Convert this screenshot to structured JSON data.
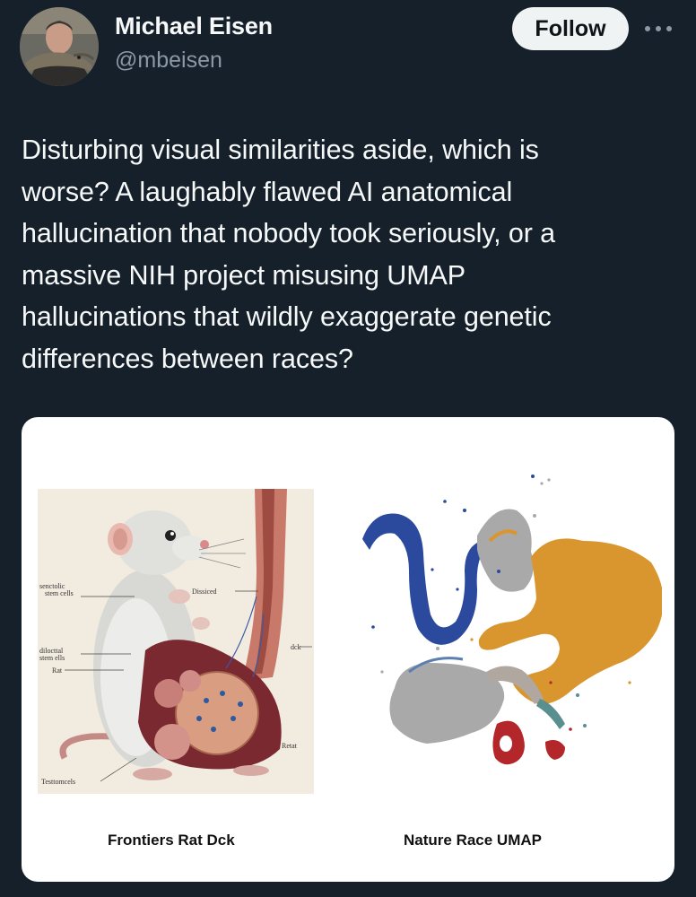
{
  "author": {
    "name": "Michael Eisen",
    "handle": "@mbeisen",
    "avatar_icon": "profile-photo-with-lizard"
  },
  "actions": {
    "follow_label": "Follow",
    "more_icon": "more-horizontal-icon"
  },
  "tweet": {
    "lines": [
      "Disturbing visual similarities aside, which is",
      "worse? A laughably flawed AI anatomical",
      "hallucination that nobody took seriously, or a",
      "massive NIH project misusing UMAP",
      "hallucinations that wildly exaggerate genetic",
      "differences between races?"
    ]
  },
  "media": {
    "rat_labels": {
      "senctolic": "senctolic",
      "stem_cells": "stem cells",
      "dissiced": "Dissiced",
      "dck": "dck",
      "dilocttal": "dilocttal",
      "stem_ells": "stem ells",
      "rat": "Rat",
      "retat": "Retat",
      "testtomcels": "Testtomcels"
    },
    "caption_left": "Frontiers Rat Dck",
    "caption_right": "Nature Race UMAP"
  },
  "colors": {
    "background": "#15202b",
    "text_primary": "#f7f9f9",
    "text_secondary": "#8b98a5",
    "follow_bg": "#eff3f4",
    "umap_blue": "#2b4a9e",
    "umap_orange": "#d9962f",
    "umap_gray": "#a9a9a9",
    "umap_red": "#b3262a"
  }
}
